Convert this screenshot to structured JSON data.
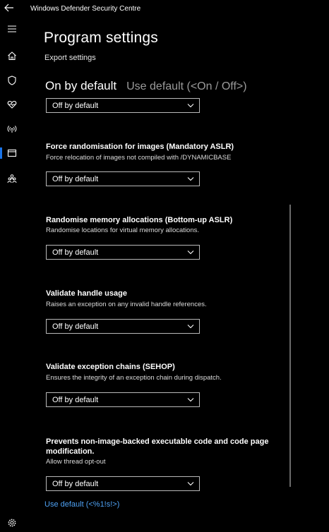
{
  "app": {
    "title": "Windows Defender Security Centre"
  },
  "page": {
    "title": "Program settings",
    "export_link": "Export settings"
  },
  "tooltip": {
    "on": "On by default",
    "default": "Use default (<On / Off>)"
  },
  "top_dropdown": {
    "value": "Off by default"
  },
  "settings": [
    {
      "title": "Force randomisation for images (Mandatory ASLR)",
      "description": "Force relocation of images not compiled with /DYNAMICBASE",
      "value": "Off by default"
    },
    {
      "title": "Randomise memory allocations (Bottom-up ASLR)",
      "description": "Randomise locations for virtual memory allocations.",
      "value": "Off by default"
    },
    {
      "title": "Validate handle usage",
      "description": "Raises an exception on any invalid handle references.",
      "value": "Off by default"
    },
    {
      "title": "Validate exception chains (SEHOP)",
      "description": "Ensures the integrity of an exception chain during dispatch.",
      "value": "Off by default"
    },
    {
      "title_line1": "Prevents non-image-backed executable code and code page",
      "title_line2": "modification.",
      "description": "Allow thread opt-out",
      "value": "Off by default"
    }
  ],
  "use_default_link": "Use default (<%1!s!>)",
  "nav": [
    "back-icon",
    "hamburger-icon",
    "home-icon",
    "shield-icon",
    "heart-icon",
    "wifi-icon",
    "app-browser-icon",
    "family-icon",
    "gear-icon"
  ],
  "colors": {
    "background": "#000000",
    "accent": "#1a73e8",
    "link": "#4ea1f3",
    "dropdown_border": "#b9b9b9"
  }
}
